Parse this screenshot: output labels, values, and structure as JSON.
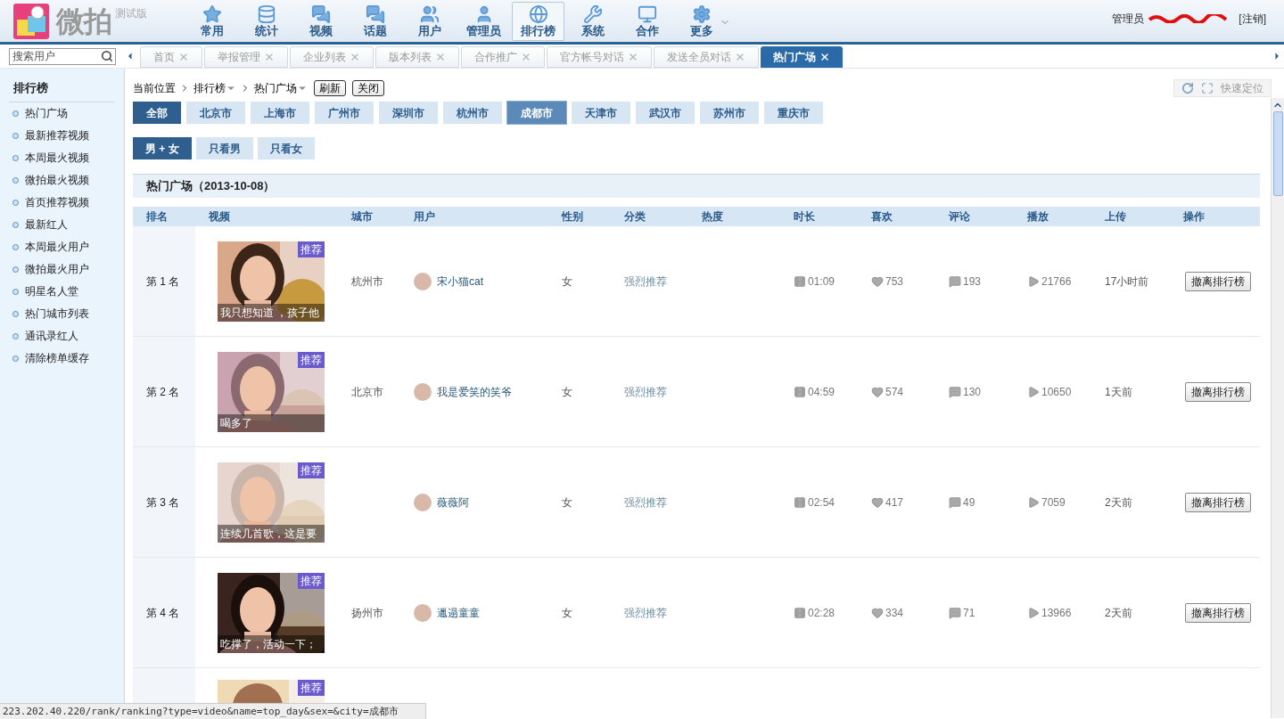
{
  "app": {
    "logo_text": "微拍",
    "edition": "测试版"
  },
  "nav": [
    {
      "label": "常用",
      "selected": false
    },
    {
      "label": "统计",
      "selected": false
    },
    {
      "label": "视频",
      "selected": false
    },
    {
      "label": "话题",
      "selected": false
    },
    {
      "label": "用户",
      "selected": false
    },
    {
      "label": "管理员",
      "selected": false
    },
    {
      "label": "排行榜",
      "selected": true
    },
    {
      "label": "系统",
      "selected": false
    },
    {
      "label": "合作",
      "selected": false
    },
    {
      "label": "更多",
      "selected": false,
      "dropdown": true
    }
  ],
  "user": {
    "role": "管理员",
    "logout": "[注销]"
  },
  "search": {
    "placeholder": "搜索用户"
  },
  "tabs": [
    {
      "label": "首页",
      "selected": false
    },
    {
      "label": "举报管理",
      "selected": false
    },
    {
      "label": "企业列表",
      "selected": false
    },
    {
      "label": "版本列表",
      "selected": false
    },
    {
      "label": "合作推广",
      "selected": false
    },
    {
      "label": "官方帐号对话",
      "selected": false
    },
    {
      "label": "发送全员对话",
      "selected": false
    },
    {
      "label": "热门广场",
      "selected": true
    }
  ],
  "sidebar": {
    "title": "排行榜",
    "items": [
      "热门广场",
      "最新推荐视频",
      "本周最火视频",
      "微拍最火视频",
      "首页推荐视频",
      "最新红人",
      "本周最火用户",
      "微拍最火用户",
      "明星名人堂",
      "热门城市列表",
      "通讯录红人",
      "清除榜单缓存"
    ]
  },
  "breadcrumb": {
    "label": "当前位置",
    "items": [
      "排行榜",
      "热门广场"
    ],
    "buttons": [
      "刷新",
      "关闭"
    ]
  },
  "quick_locate": "快速定位",
  "city_filters": [
    {
      "label": "全部",
      "selected": true,
      "highlighted": false
    },
    {
      "label": "北京市",
      "selected": false,
      "highlighted": false
    },
    {
      "label": "上海市",
      "selected": false,
      "highlighted": false
    },
    {
      "label": "广州市",
      "selected": false,
      "highlighted": false
    },
    {
      "label": "深圳市",
      "selected": false,
      "highlighted": false
    },
    {
      "label": "杭州市",
      "selected": false,
      "highlighted": false
    },
    {
      "label": "成都市",
      "selected": false,
      "highlighted": true
    },
    {
      "label": "天津市",
      "selected": false,
      "highlighted": false
    },
    {
      "label": "武汉市",
      "selected": false,
      "highlighted": false
    },
    {
      "label": "苏州市",
      "selected": false,
      "highlighted": false
    },
    {
      "label": "重庆市",
      "selected": false,
      "highlighted": false
    }
  ],
  "sex_filters": [
    {
      "label": "男 + 女",
      "selected": true
    },
    {
      "label": "只看男",
      "selected": false
    },
    {
      "label": "只看女",
      "selected": false
    }
  ],
  "section_title": "热门广场（2013-10-08）",
  "table": {
    "columns": [
      "排名",
      "视频",
      "城市",
      "用户",
      "性别",
      "分类",
      "热度",
      "时长",
      "喜欢",
      "评论",
      "播放",
      "上传",
      "操作"
    ],
    "rows": [
      {
        "rank": "第 1 名",
        "caption": "我只想知道 ，孩子他",
        "badge": "推荐",
        "city": "杭州市",
        "user": "宋小猫cat",
        "gender": "女",
        "category": "强烈推荐",
        "duration": "01:09",
        "likes": "753",
        "comments": "193",
        "plays": "21766",
        "uploaded": "17小时前",
        "action": "撤离排行榜"
      },
      {
        "rank": "第 2 名",
        "caption": "喝多了",
        "badge": "推荐",
        "city": "北京市",
        "user": "我是爱笑的笑爷",
        "gender": "女",
        "category": "强烈推荐",
        "duration": "04:59",
        "likes": "574",
        "comments": "130",
        "plays": "10650",
        "uploaded": "1天前",
        "action": "撤离排行榜"
      },
      {
        "rank": "第 3 名",
        "caption": "连续几首歌，这是要",
        "badge": "推荐",
        "user": "薇薇阿",
        "gender": "女",
        "category": "强烈推荐",
        "duration": "02:54",
        "likes": "417",
        "comments": "49",
        "plays": "7059",
        "uploaded": "2天前",
        "action": "撤离排行榜"
      },
      {
        "rank": "第 4 名",
        "caption": "吃撑了，活动一下；",
        "badge": "推荐",
        "city": "扬州市",
        "user": "邋遢童童",
        "gender": "女",
        "category": "强烈推荐",
        "duration": "02:28",
        "likes": "334",
        "comments": "71",
        "plays": "13966",
        "uploaded": "2天前",
        "action": "撤离排行榜"
      }
    ],
    "partial_row": {
      "badge": "推荐"
    }
  },
  "status_bar": "223.202.40.220/rank/ranking?type=video&name=top_day&sex=&city=成都市"
}
